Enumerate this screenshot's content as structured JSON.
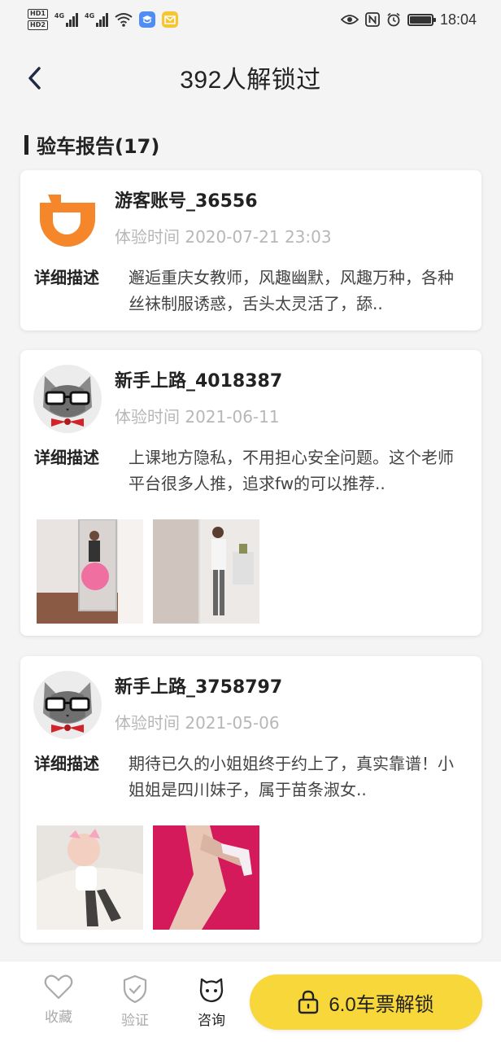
{
  "status_bar": {
    "hd_badges": [
      "HD1",
      "HD2"
    ],
    "sim1_label": "4G",
    "sim2_label": "4G",
    "icons": [
      "wifi-icon",
      "study-app-icon",
      "mail-app-icon",
      "eye-icon",
      "nfc-icon",
      "alarm-icon",
      "battery-icon"
    ],
    "time": "18:04"
  },
  "header": {
    "back_icon": "chevron-left-icon",
    "title": "392人解锁过"
  },
  "section": {
    "title": "验车报告(17)"
  },
  "reports": [
    {
      "avatar": "orange-d-logo-avatar",
      "username": "游客账号_36556",
      "time_label": "体验时间",
      "time": "2020-07-21 23:03",
      "desc_label": "详细描述",
      "desc": "邂逅重庆女教师，风趣幽默，风趣万种，各种丝袜制服诱惑，舌头太灵活了，舔..",
      "photos": []
    },
    {
      "avatar": "cat-with-glasses-avatar",
      "username": "新手上路_4018387",
      "time_label": "体验时间",
      "time": "2021-06-11",
      "desc_label": "详细描述",
      "desc": "上课地方隐私，不用担心安全问题。这个老师平台很多人推，追求fw的可以推荐..",
      "photos": [
        "mirror-selfie-photo",
        "mirror-selfie-photo-2"
      ]
    },
    {
      "avatar": "cat-with-glasses-avatar",
      "username": "新手上路_3758797",
      "time_label": "体验时间",
      "time": "2021-05-06",
      "desc_label": "详细描述",
      "desc": "期待已久的小姐姐终于约上了，真实靠谱！小姐姐是四川妹子，属于苗条淑女..",
      "photos": [
        "fishnet-stockings-photo",
        "heels-legs-photo"
      ]
    }
  ],
  "bottom_bar": {
    "tabs": [
      {
        "label": "收藏",
        "icon": "heart-icon"
      },
      {
        "label": "验证",
        "icon": "shield-check-icon"
      },
      {
        "label": "咨询",
        "icon": "chat-cat-icon"
      }
    ],
    "unlock_button": "6.0车票解锁",
    "unlock_icon": "lock-icon"
  },
  "colors": {
    "accent_yellow": "#f7d73a",
    "avatar_orange": "#f5862a",
    "muted_text": "#b7b7b7"
  }
}
